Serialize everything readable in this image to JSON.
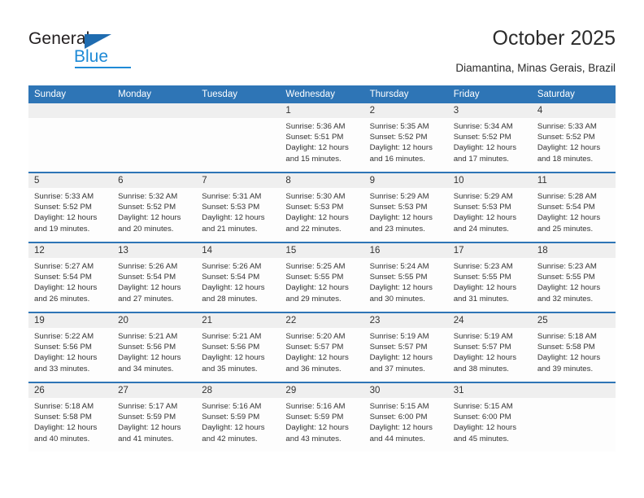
{
  "brand": {
    "name_top": "General",
    "name_bottom": "Blue",
    "triangle_color": "#1f6cb0",
    "blue_color": "#1f8ad6"
  },
  "header": {
    "title": "October 2025",
    "subtitle": "Diamantina, Minas Gerais, Brazil",
    "accent_color": "#2e75b6"
  },
  "calendar": {
    "columns": [
      "Sunday",
      "Monday",
      "Tuesday",
      "Wednesday",
      "Thursday",
      "Friday",
      "Saturday"
    ],
    "labels": {
      "sunrise": "Sunrise:",
      "sunset": "Sunset:",
      "daylight": "Daylight:"
    },
    "weeks": [
      [
        {
          "day": "",
          "sunrise": "",
          "sunset": "",
          "daylight_1": "",
          "daylight_2": ""
        },
        {
          "day": "",
          "sunrise": "",
          "sunset": "",
          "daylight_1": "",
          "daylight_2": ""
        },
        {
          "day": "",
          "sunrise": "",
          "sunset": "",
          "daylight_1": "",
          "daylight_2": ""
        },
        {
          "day": "1",
          "sunrise": "Sunrise: 5:36 AM",
          "sunset": "Sunset: 5:51 PM",
          "daylight_1": "Daylight: 12 hours",
          "daylight_2": "and 15 minutes."
        },
        {
          "day": "2",
          "sunrise": "Sunrise: 5:35 AM",
          "sunset": "Sunset: 5:52 PM",
          "daylight_1": "Daylight: 12 hours",
          "daylight_2": "and 16 minutes."
        },
        {
          "day": "3",
          "sunrise": "Sunrise: 5:34 AM",
          "sunset": "Sunset: 5:52 PM",
          "daylight_1": "Daylight: 12 hours",
          "daylight_2": "and 17 minutes."
        },
        {
          "day": "4",
          "sunrise": "Sunrise: 5:33 AM",
          "sunset": "Sunset: 5:52 PM",
          "daylight_1": "Daylight: 12 hours",
          "daylight_2": "and 18 minutes."
        }
      ],
      [
        {
          "day": "5",
          "sunrise": "Sunrise: 5:33 AM",
          "sunset": "Sunset: 5:52 PM",
          "daylight_1": "Daylight: 12 hours",
          "daylight_2": "and 19 minutes."
        },
        {
          "day": "6",
          "sunrise": "Sunrise: 5:32 AM",
          "sunset": "Sunset: 5:52 PM",
          "daylight_1": "Daylight: 12 hours",
          "daylight_2": "and 20 minutes."
        },
        {
          "day": "7",
          "sunrise": "Sunrise: 5:31 AM",
          "sunset": "Sunset: 5:53 PM",
          "daylight_1": "Daylight: 12 hours",
          "daylight_2": "and 21 minutes."
        },
        {
          "day": "8",
          "sunrise": "Sunrise: 5:30 AM",
          "sunset": "Sunset: 5:53 PM",
          "daylight_1": "Daylight: 12 hours",
          "daylight_2": "and 22 minutes."
        },
        {
          "day": "9",
          "sunrise": "Sunrise: 5:29 AM",
          "sunset": "Sunset: 5:53 PM",
          "daylight_1": "Daylight: 12 hours",
          "daylight_2": "and 23 minutes."
        },
        {
          "day": "10",
          "sunrise": "Sunrise: 5:29 AM",
          "sunset": "Sunset: 5:53 PM",
          "daylight_1": "Daylight: 12 hours",
          "daylight_2": "and 24 minutes."
        },
        {
          "day": "11",
          "sunrise": "Sunrise: 5:28 AM",
          "sunset": "Sunset: 5:54 PM",
          "daylight_1": "Daylight: 12 hours",
          "daylight_2": "and 25 minutes."
        }
      ],
      [
        {
          "day": "12",
          "sunrise": "Sunrise: 5:27 AM",
          "sunset": "Sunset: 5:54 PM",
          "daylight_1": "Daylight: 12 hours",
          "daylight_2": "and 26 minutes."
        },
        {
          "day": "13",
          "sunrise": "Sunrise: 5:26 AM",
          "sunset": "Sunset: 5:54 PM",
          "daylight_1": "Daylight: 12 hours",
          "daylight_2": "and 27 minutes."
        },
        {
          "day": "14",
          "sunrise": "Sunrise: 5:26 AM",
          "sunset": "Sunset: 5:54 PM",
          "daylight_1": "Daylight: 12 hours",
          "daylight_2": "and 28 minutes."
        },
        {
          "day": "15",
          "sunrise": "Sunrise: 5:25 AM",
          "sunset": "Sunset: 5:55 PM",
          "daylight_1": "Daylight: 12 hours",
          "daylight_2": "and 29 minutes."
        },
        {
          "day": "16",
          "sunrise": "Sunrise: 5:24 AM",
          "sunset": "Sunset: 5:55 PM",
          "daylight_1": "Daylight: 12 hours",
          "daylight_2": "and 30 minutes."
        },
        {
          "day": "17",
          "sunrise": "Sunrise: 5:23 AM",
          "sunset": "Sunset: 5:55 PM",
          "daylight_1": "Daylight: 12 hours",
          "daylight_2": "and 31 minutes."
        },
        {
          "day": "18",
          "sunrise": "Sunrise: 5:23 AM",
          "sunset": "Sunset: 5:55 PM",
          "daylight_1": "Daylight: 12 hours",
          "daylight_2": "and 32 minutes."
        }
      ],
      [
        {
          "day": "19",
          "sunrise": "Sunrise: 5:22 AM",
          "sunset": "Sunset: 5:56 PM",
          "daylight_1": "Daylight: 12 hours",
          "daylight_2": "and 33 minutes."
        },
        {
          "day": "20",
          "sunrise": "Sunrise: 5:21 AM",
          "sunset": "Sunset: 5:56 PM",
          "daylight_1": "Daylight: 12 hours",
          "daylight_2": "and 34 minutes."
        },
        {
          "day": "21",
          "sunrise": "Sunrise: 5:21 AM",
          "sunset": "Sunset: 5:56 PM",
          "daylight_1": "Daylight: 12 hours",
          "daylight_2": "and 35 minutes."
        },
        {
          "day": "22",
          "sunrise": "Sunrise: 5:20 AM",
          "sunset": "Sunset: 5:57 PM",
          "daylight_1": "Daylight: 12 hours",
          "daylight_2": "and 36 minutes."
        },
        {
          "day": "23",
          "sunrise": "Sunrise: 5:19 AM",
          "sunset": "Sunset: 5:57 PM",
          "daylight_1": "Daylight: 12 hours",
          "daylight_2": "and 37 minutes."
        },
        {
          "day": "24",
          "sunrise": "Sunrise: 5:19 AM",
          "sunset": "Sunset: 5:57 PM",
          "daylight_1": "Daylight: 12 hours",
          "daylight_2": "and 38 minutes."
        },
        {
          "day": "25",
          "sunrise": "Sunrise: 5:18 AM",
          "sunset": "Sunset: 5:58 PM",
          "daylight_1": "Daylight: 12 hours",
          "daylight_2": "and 39 minutes."
        }
      ],
      [
        {
          "day": "26",
          "sunrise": "Sunrise: 5:18 AM",
          "sunset": "Sunset: 5:58 PM",
          "daylight_1": "Daylight: 12 hours",
          "daylight_2": "and 40 minutes."
        },
        {
          "day": "27",
          "sunrise": "Sunrise: 5:17 AM",
          "sunset": "Sunset: 5:59 PM",
          "daylight_1": "Daylight: 12 hours",
          "daylight_2": "and 41 minutes."
        },
        {
          "day": "28",
          "sunrise": "Sunrise: 5:16 AM",
          "sunset": "Sunset: 5:59 PM",
          "daylight_1": "Daylight: 12 hours",
          "daylight_2": "and 42 minutes."
        },
        {
          "day": "29",
          "sunrise": "Sunrise: 5:16 AM",
          "sunset": "Sunset: 5:59 PM",
          "daylight_1": "Daylight: 12 hours",
          "daylight_2": "and 43 minutes."
        },
        {
          "day": "30",
          "sunrise": "Sunrise: 5:15 AM",
          "sunset": "Sunset: 6:00 PM",
          "daylight_1": "Daylight: 12 hours",
          "daylight_2": "and 44 minutes."
        },
        {
          "day": "31",
          "sunrise": "Sunrise: 5:15 AM",
          "sunset": "Sunset: 6:00 PM",
          "daylight_1": "Daylight: 12 hours",
          "daylight_2": "and 45 minutes."
        },
        {
          "day": "",
          "sunrise": "",
          "sunset": "",
          "daylight_1": "",
          "daylight_2": ""
        }
      ]
    ]
  }
}
